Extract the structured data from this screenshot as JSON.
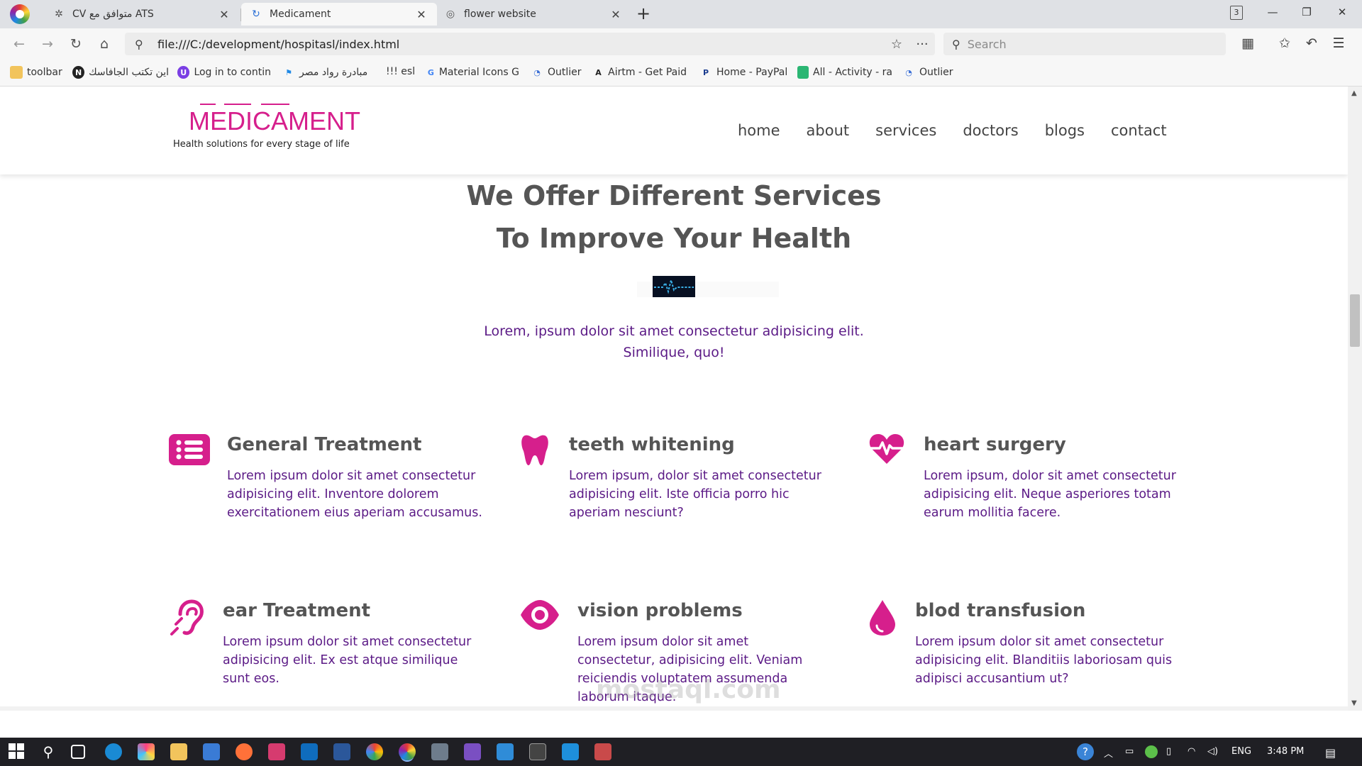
{
  "browser": {
    "tabs": [
      {
        "title": "CV متوافق مع ATS",
        "icon": "openai-icon",
        "active": false
      },
      {
        "title": "Medicament",
        "icon": "loading-icon",
        "active": true
      },
      {
        "title": "flower website",
        "icon": "globe-icon",
        "active": false
      }
    ],
    "url": "file:///C:/development/hospitasl/index.html",
    "search_placeholder": "Search",
    "tab_count": "3",
    "bookmarks": [
      {
        "label": "toolbar",
        "icon": "folder-icon"
      },
      {
        "label": "اين تكتب الجافاسك",
        "icon": "notion-icon"
      },
      {
        "label": "Log in to contin",
        "icon": "u-icon"
      },
      {
        "label": "مبادرة رواد مصر",
        "icon": "flag-icon"
      },
      {
        "label": "!!! esl",
        "icon": "text-icon"
      },
      {
        "label": "Material Icons G",
        "icon": "google-icon"
      },
      {
        "label": "Outlier",
        "icon": "outlier-icon"
      },
      {
        "label": "Airtm - Get Paid",
        "icon": "airtm-icon"
      },
      {
        "label": "Home - PayPal",
        "icon": "paypal-icon"
      },
      {
        "label": "All - Activity - ra",
        "icon": "activity-icon"
      },
      {
        "label": "Outlier",
        "icon": "outlier-icon"
      }
    ]
  },
  "site": {
    "logo_name": "MEDICAMENT",
    "logo_tagline": "Health solutions for every stage of life",
    "nav": [
      "home",
      "about",
      "services",
      "doctors",
      "blogs",
      "contact"
    ],
    "section_title": "We Offer Different Services To Improve Your Health",
    "section_subtitle": "Lorem, ipsum dolor sit amet consectetur adipisicing elit. Similique, quo!",
    "accent_color": "#d61f8c",
    "text_color": "#5b1a86",
    "services": [
      {
        "title": "General Treatment",
        "icon": "list-icon",
        "text": "Lorem ipsum dolor sit amet consectetur adipisicing elit. Inventore dolorem exercitationem eius aperiam accusamus."
      },
      {
        "title": "teeth whitening",
        "icon": "tooth-icon",
        "text": "Lorem ipsum, dolor sit amet consectetur adipisicing elit. Iste officia porro hic aperiam nesciunt?"
      },
      {
        "title": "heart surgery",
        "icon": "heartbeat-icon",
        "text": "Lorem ipsum, dolor sit amet consectetur adipisicing elit. Neque asperiores totam earum mollitia facere."
      },
      {
        "title": "ear Treatment",
        "icon": "ear-icon",
        "text": "Lorem ipsum dolor sit amet consectetur adipisicing elit. Ex est atque similique sunt eos."
      },
      {
        "title": "vision problems",
        "icon": "eye-icon",
        "text": "Lorem ipsum dolor sit amet consectetur, adipisicing elit. Veniam reiciendis voluptatem assumenda laborum itaque."
      },
      {
        "title": "blod transfusion",
        "icon": "blood-drop-icon",
        "text": "Lorem ipsum dolor sit amet consectetur adipisicing elit. Blanditiis laboriosam quis adipisci accusantium ut?"
      }
    ]
  },
  "watermark": "mostaql.com",
  "taskbar": {
    "language": "ENG",
    "time": "3:48 PM"
  }
}
